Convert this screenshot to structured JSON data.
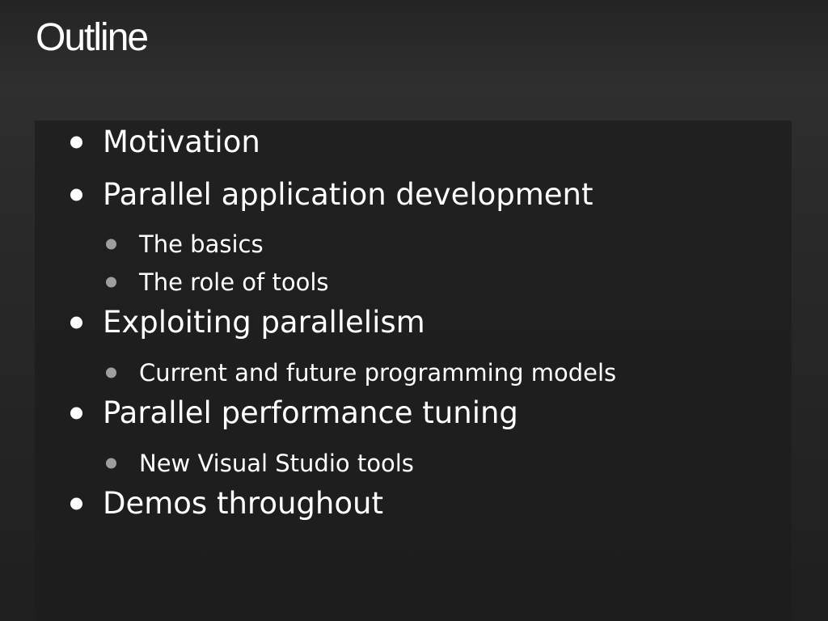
{
  "slide": {
    "title": "Outline",
    "bullets": [
      {
        "text": "Motivation",
        "level": 1
      },
      {
        "text": "Parallel application development",
        "level": 1
      },
      {
        "text": "The basics",
        "level": 2
      },
      {
        "text": "The role of tools",
        "level": 2
      },
      {
        "text": "Exploiting parallelism",
        "level": 1
      },
      {
        "text": "Current and future programming models",
        "level": 2
      },
      {
        "text": "Parallel performance tuning",
        "level": 1
      },
      {
        "text": "New Visual Studio tools",
        "level": 2
      },
      {
        "text": "Demos throughout",
        "level": 1
      }
    ],
    "colors": {
      "background": "#2a2a2a",
      "content_box": "#1f1f1f",
      "text": "#ffffff",
      "sub_bullet": "#9e9e9e"
    }
  }
}
